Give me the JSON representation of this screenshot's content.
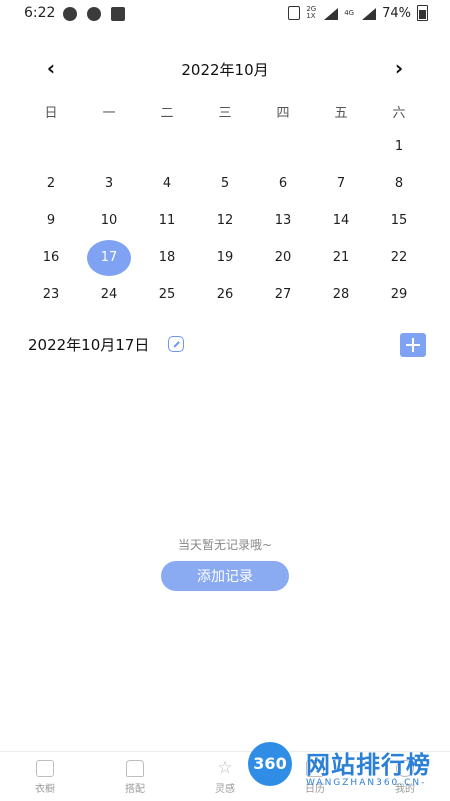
{
  "status_bar": {
    "time": "6:22",
    "network_top": "2G",
    "network_bottom": "1X",
    "network_4g": "4G",
    "battery": "74%"
  },
  "calendar": {
    "month_title": "2022年10月",
    "prev_icon": "chevron-left",
    "next_icon": "chevron-right",
    "weekdays": [
      "日",
      "一",
      "二",
      "三",
      "四",
      "五",
      "六"
    ],
    "weeks": [
      [
        "",
        "",
        "",
        "",
        "",
        "",
        "1"
      ],
      [
        "2",
        "3",
        "4",
        "5",
        "6",
        "7",
        "8"
      ],
      [
        "9",
        "10",
        "11",
        "12",
        "13",
        "14",
        "15"
      ],
      [
        "16",
        "17",
        "18",
        "19",
        "20",
        "21",
        "22"
      ],
      [
        "23",
        "24",
        "25",
        "26",
        "27",
        "28",
        "29"
      ]
    ],
    "selected_day": "17",
    "accent_color": "#7fa3f2"
  },
  "day_panel": {
    "date_label": "2022年10月17日",
    "empty_message": "当天暂无记录哦~",
    "add_record_label": "添加记录"
  },
  "bottom_nav": [
    {
      "label": "衣橱",
      "icon": "wardrobe-icon"
    },
    {
      "label": "搭配",
      "icon": "shirt-icon"
    },
    {
      "label": "灵感",
      "icon": "star-icon"
    },
    {
      "label": "日历",
      "icon": "calendar-icon"
    },
    {
      "label": "我的",
      "icon": "profile-icon"
    }
  ],
  "watermark": {
    "badge": "360",
    "title": "网站排行榜",
    "subtitle": "WANGZHAN360.CN-"
  }
}
